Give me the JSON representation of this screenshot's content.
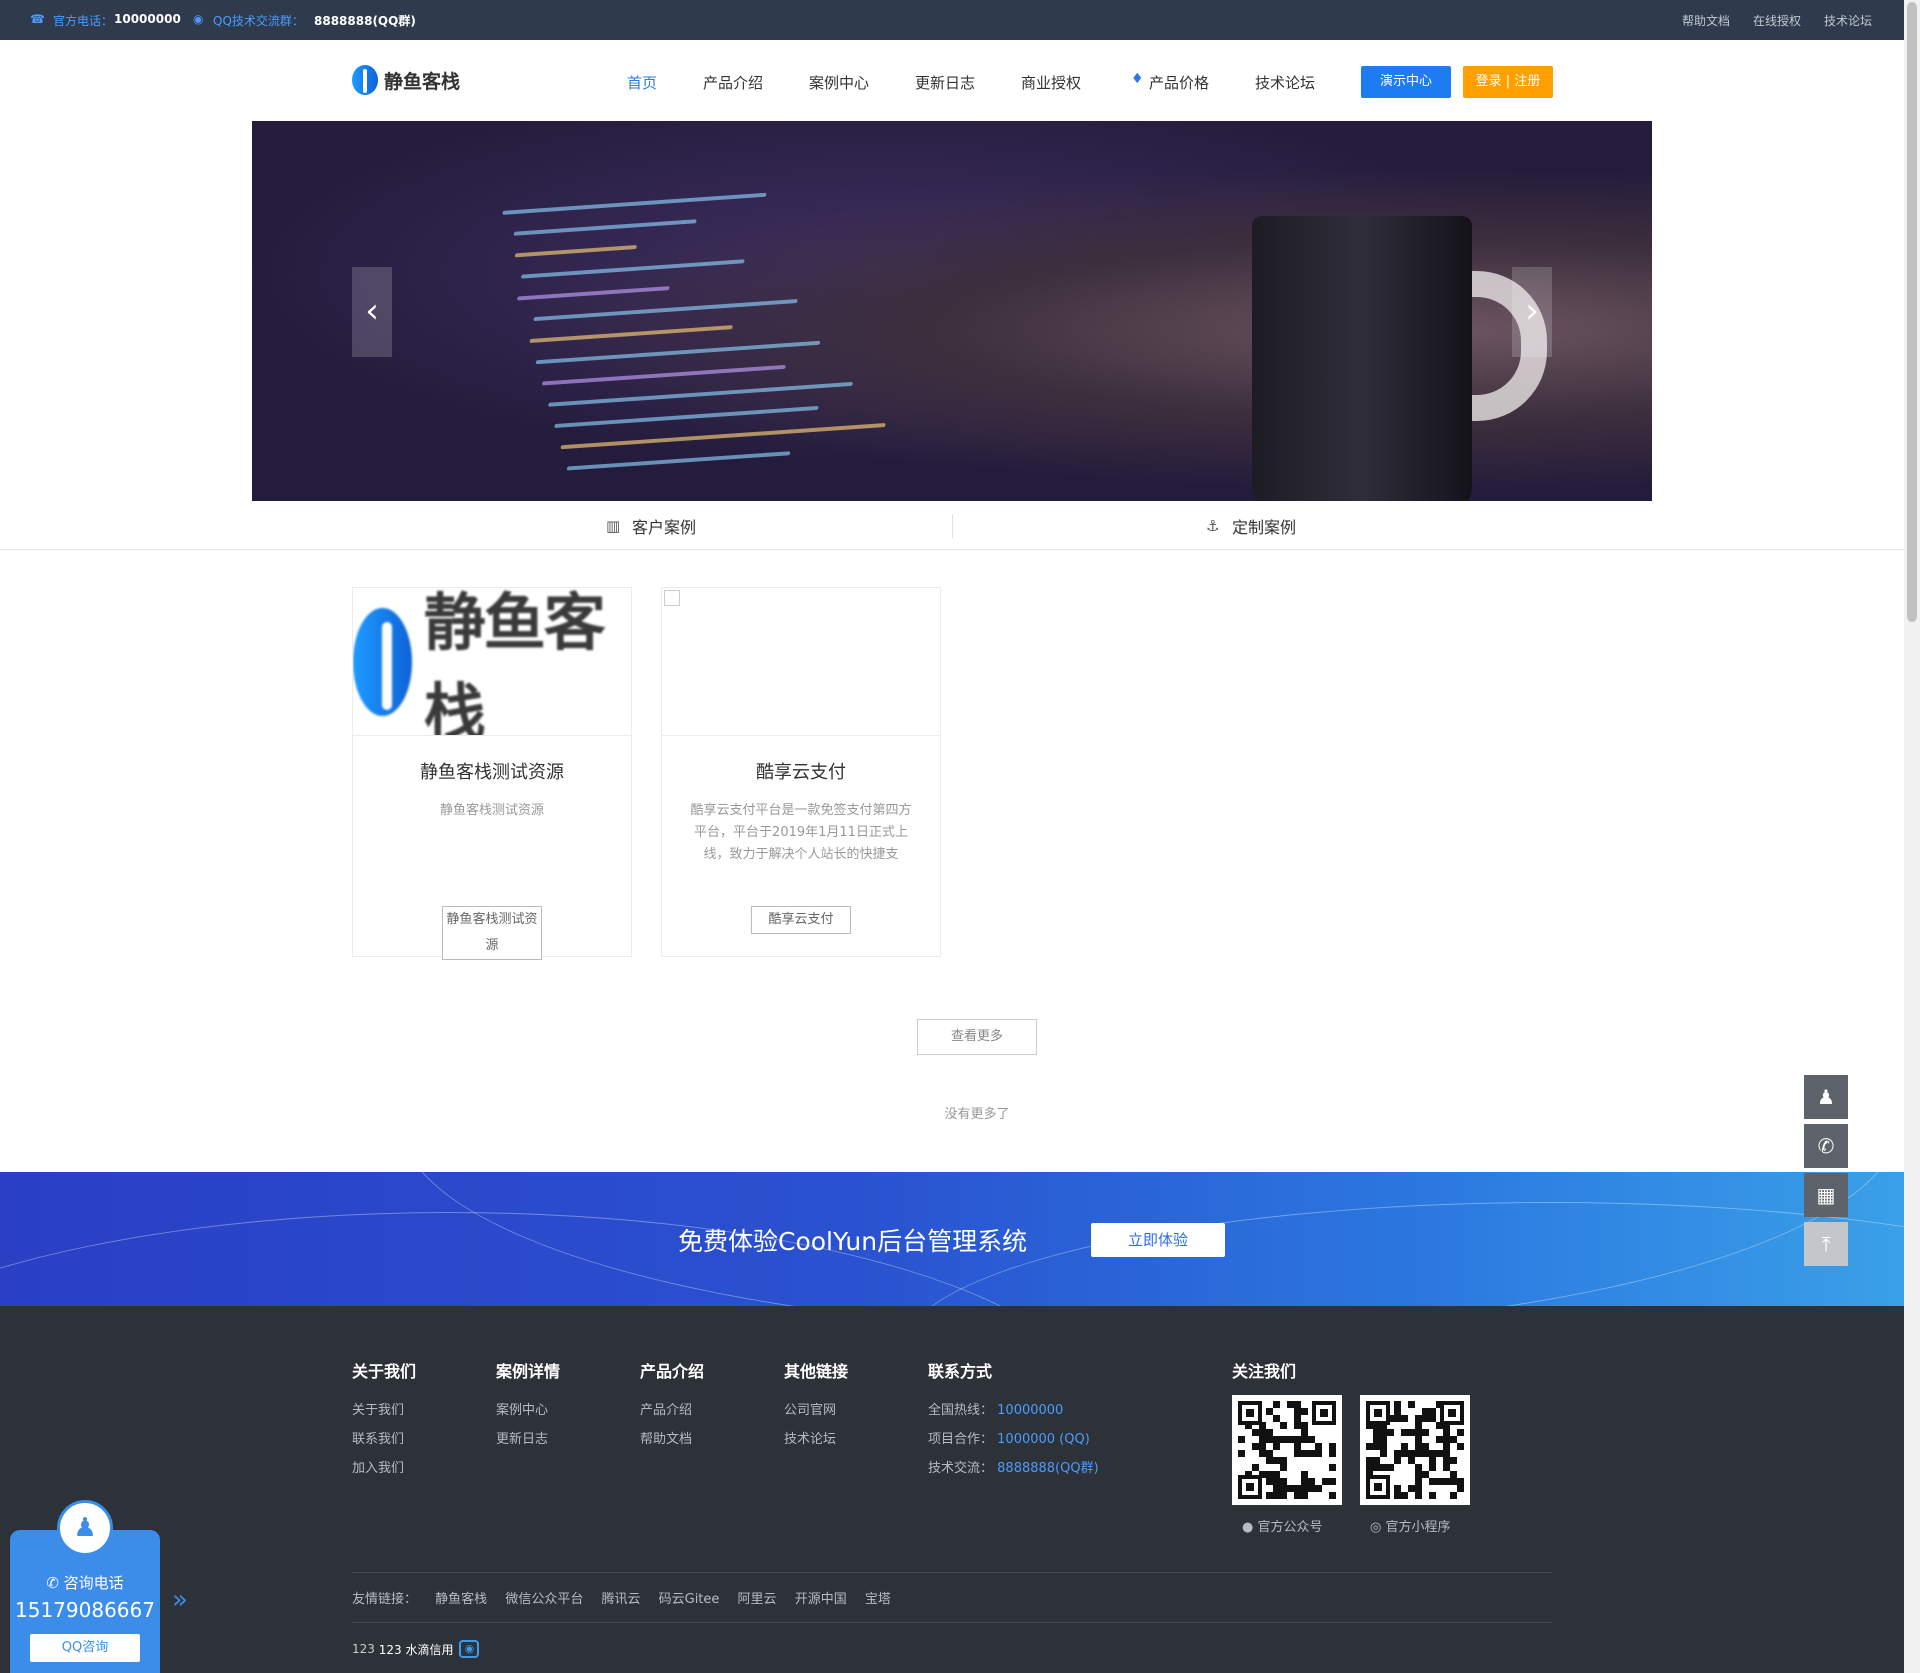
{
  "topbar": {
    "phone_label": "官方电话：",
    "phone_value": "10000000",
    "qq_label": "QQ技术交流群：",
    "qq_value": "8888888(QQ群)",
    "links": [
      "帮助文档",
      "在线授权",
      "技术论坛"
    ]
  },
  "header": {
    "logo_text": "静鱼客栈",
    "nav": [
      "首页",
      "产品介绍",
      "案例中心",
      "更新日志",
      "商业授权",
      "产品价格",
      "技术论坛"
    ],
    "demo_button": "演示中心",
    "login_button": "登录 | 注册"
  },
  "tabs": [
    "客户案例",
    "定制案例"
  ],
  "cards": [
    {
      "logo_text": "静鱼客栈",
      "title": "静鱼客栈测试资源",
      "desc": "静鱼客栈测试资源",
      "button": "静鱼客栈测试资源"
    },
    {
      "title": "酷享云支付",
      "desc": "酷享云支付平台是一款免签支付第四方平台，平台于2019年1月11日正式上线，致力于解决个人站长的快捷支",
      "button": "酷享云支付"
    }
  ],
  "see_more": "查看更多",
  "no_more": "没有更多了",
  "cta": {
    "title": "免费体验CoolYun后台管理系统",
    "button": "立即体验"
  },
  "footer": {
    "columns": [
      {
        "title": "关于我们",
        "links": [
          "关于我们",
          "联系我们",
          "加入我们"
        ]
      },
      {
        "title": "案例详情",
        "links": [
          "案例中心",
          "更新日志"
        ]
      },
      {
        "title": "产品介绍",
        "links": [
          "产品介绍",
          "帮助文档"
        ]
      },
      {
        "title": "其他链接",
        "links": [
          "公司官网",
          "技术论坛"
        ]
      }
    ],
    "contact": {
      "title": "联系方式",
      "rows": [
        {
          "label": "全国热线：",
          "value": "10000000"
        },
        {
          "label": "项目合作：",
          "value": "1000000 (QQ)"
        },
        {
          "label": "技术交流：",
          "value": "8888888(QQ群)"
        }
      ]
    },
    "follow": {
      "title": "关注我们",
      "qr1_caption": "官方公众号",
      "qr2_caption": "官方小程序"
    },
    "friend_label": "友情链接：",
    "friend_links": [
      "静鱼客栈",
      "微信公众平台",
      "腾讯云",
      "码云Gitee",
      "阿里云",
      "开源中国",
      "宝塔"
    ],
    "copyright_prefix": "123",
    "copyright_text": "123 水滴信用"
  },
  "consult": {
    "label": "咨询电话",
    "number": "15179086667",
    "qq_button": "QQ咨询"
  }
}
